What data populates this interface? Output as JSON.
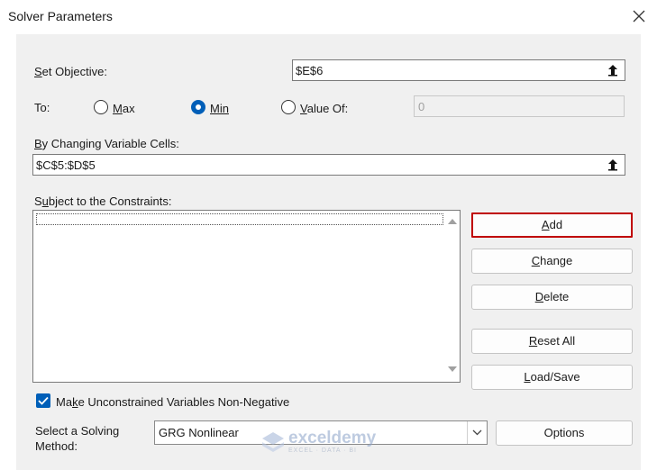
{
  "window": {
    "title": "Solver Parameters"
  },
  "objective": {
    "label_key": "S",
    "label_rest": "et Objective:",
    "value": "$E$6"
  },
  "to": {
    "label": "To:",
    "max": {
      "key": "M",
      "rest": "ax"
    },
    "min": {
      "key": "Min",
      "rest": ""
    },
    "value_of": {
      "key": "V",
      "rest": "alue Of:"
    },
    "value": "0",
    "selected": "min"
  },
  "changing_cells": {
    "label_key": "B",
    "label_rest": "y Changing Variable Cells:",
    "value": "$C$5:$D$5"
  },
  "constraints": {
    "label_key": "u",
    "label_pre": "S",
    "label_rest": "bject to the Constraints:",
    "items": []
  },
  "buttons": {
    "add": {
      "key": "A",
      "rest": "dd"
    },
    "change": {
      "key": "C",
      "rest": "hange"
    },
    "delete": {
      "key": "D",
      "rest": "elete"
    },
    "reset": {
      "key": "R",
      "rest": "eset All"
    },
    "load_save": {
      "key": "L",
      "rest": "oad/Save"
    },
    "options": "Options"
  },
  "nonnegative": {
    "key": "k",
    "pre": "Ma",
    "rest": "e Unconstrained Variables Non-Negative",
    "checked": true
  },
  "method": {
    "label_line1": "Select a Solving",
    "label_line2": "Method:",
    "value": "GRG Nonlinear"
  },
  "watermark": {
    "brand": "exceldemy",
    "tagline": "EXCEL · DATA · BI"
  },
  "colors": {
    "accent": "#005fb8",
    "highlight_border": "#c00000",
    "panel": "#f0f0f0"
  }
}
